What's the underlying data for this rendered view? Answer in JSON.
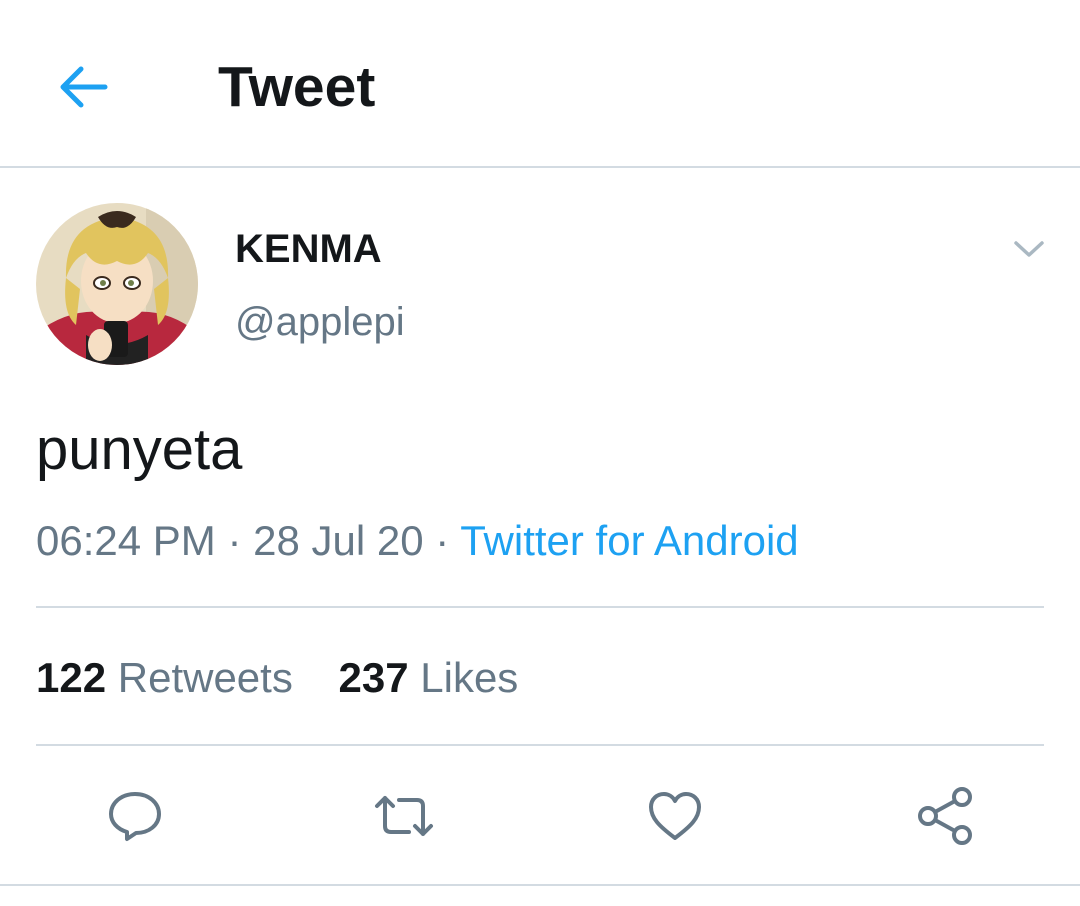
{
  "header": {
    "title": "Tweet",
    "back_icon": "back-arrow-icon"
  },
  "tweet": {
    "author": {
      "display_name": "KENMA",
      "handle": "@applepi"
    },
    "text": "punyeta",
    "time": "06:24 PM",
    "separator": "·",
    "date": "28 Jul 20",
    "source": "Twitter for Android",
    "stats": {
      "retweets_count": "122",
      "retweets_label": "Retweets",
      "likes_count": "237",
      "likes_label": "Likes"
    },
    "actions": [
      "reply-icon",
      "retweet-icon",
      "like-icon",
      "share-icon"
    ]
  },
  "colors": {
    "accent": "#1da1f2",
    "text_primary": "#14171a",
    "text_secondary": "#657786",
    "divider": "#d3dbe2"
  }
}
